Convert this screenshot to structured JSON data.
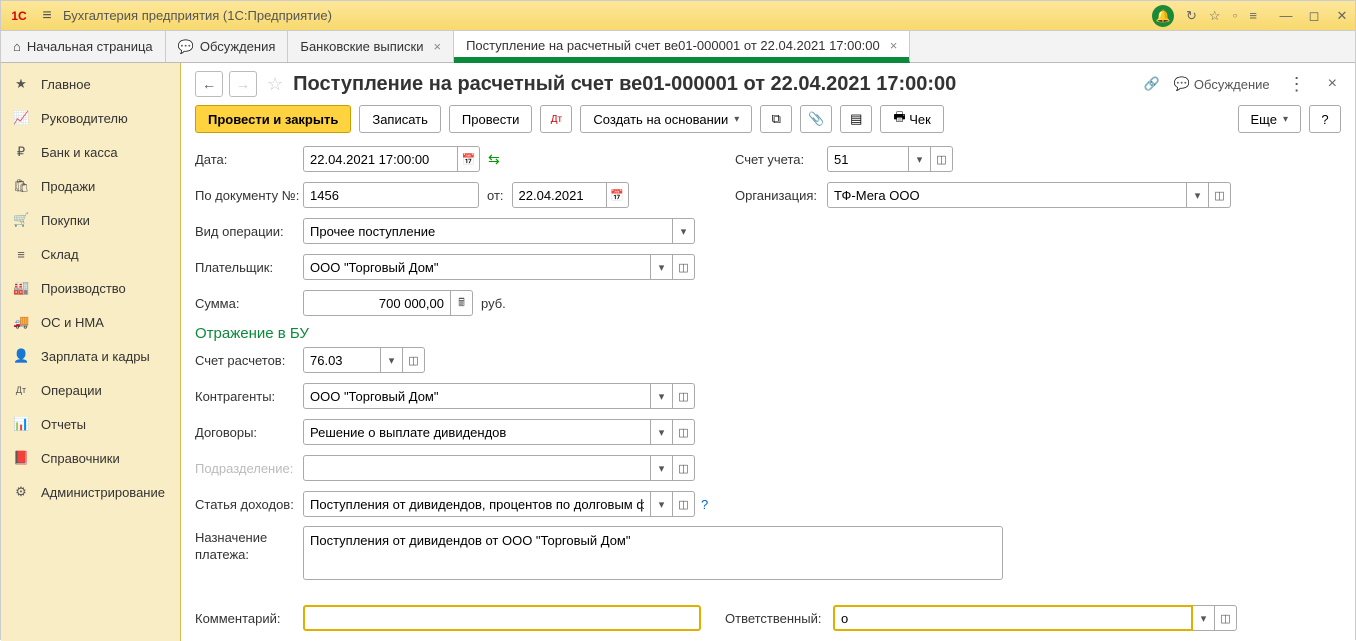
{
  "titlebar": {
    "app_title": "Бухгалтерия предприятия  (1С:Предприятие)"
  },
  "tabs": {
    "home": "Начальная страница",
    "discussions": "Обсуждения",
    "bank_statements": "Банковские выписки",
    "active": "Поступление на расчетный счет ве01-000001 от 22.04.2021 17:00:00"
  },
  "sidebar": {
    "items": [
      {
        "icon": "★",
        "label": "Главное"
      },
      {
        "icon": "📈",
        "label": "Руководителю"
      },
      {
        "icon": "₽",
        "label": "Банк и касса"
      },
      {
        "icon": "🛍",
        "label": "Продажи"
      },
      {
        "icon": "🛒",
        "label": "Покупки"
      },
      {
        "icon": "≡",
        "label": "Склад"
      },
      {
        "icon": "🏭",
        "label": "Производство"
      },
      {
        "icon": "🚚",
        "label": "ОС и НМА"
      },
      {
        "icon": "👤",
        "label": "Зарплата и кадры"
      },
      {
        "icon": "Дт",
        "label": "Операции"
      },
      {
        "icon": "📊",
        "label": "Отчеты"
      },
      {
        "icon": "📕",
        "label": "Справочники"
      },
      {
        "icon": "⚙",
        "label": "Администрирование"
      }
    ]
  },
  "doc": {
    "title": "Поступление на расчетный счет ве01-000001 от 22.04.2021 17:00:00",
    "discuss_label": "Обсуждение"
  },
  "toolbar": {
    "post_close": "Провести и закрыть",
    "save": "Записать",
    "post": "Провести",
    "create_based": "Создать на основании",
    "check": "Чек",
    "more": "Еще",
    "help": "?"
  },
  "form": {
    "date_label": "Дата:",
    "date_value": "22.04.2021 17:00:00",
    "doc_no_label": "По документу №:",
    "doc_no_value": "1456",
    "from_label": "от:",
    "from_date": "22.04.2021",
    "op_type_label": "Вид операции:",
    "op_type_value": "Прочее поступление",
    "payer_label": "Плательщик:",
    "payer_value": "ООО \"Торговый Дом\"",
    "sum_label": "Сумма:",
    "sum_value": "700 000,00",
    "sum_unit": "руб.",
    "account_label": "Счет учета:",
    "account_value": "51",
    "org_label": "Организация:",
    "org_value": "ТФ-Мега ООО",
    "section_bu": "Отражение в БУ",
    "settle_account_label": "Счет расчетов:",
    "settle_account_value": "76.03",
    "contragent_label": "Контрагенты:",
    "contragent_value": "ООО \"Торговый Дом\"",
    "contract_label": "Договоры:",
    "contract_value": "Решение о выплате дивидендов",
    "division_label": "Подразделение:",
    "division_value": "",
    "income_item_label": "Статья доходов:",
    "income_item_value": "Поступления от дивидендов, процентов по долговым финан",
    "purpose_label": "Назначение платежа:",
    "purpose_value": "Поступления от дивидендов от ООО \"Торговый Дом\"",
    "comment_label": "Комментарий:",
    "comment_value": "",
    "responsible_label": "Ответственный:",
    "responsible_value": "о"
  }
}
